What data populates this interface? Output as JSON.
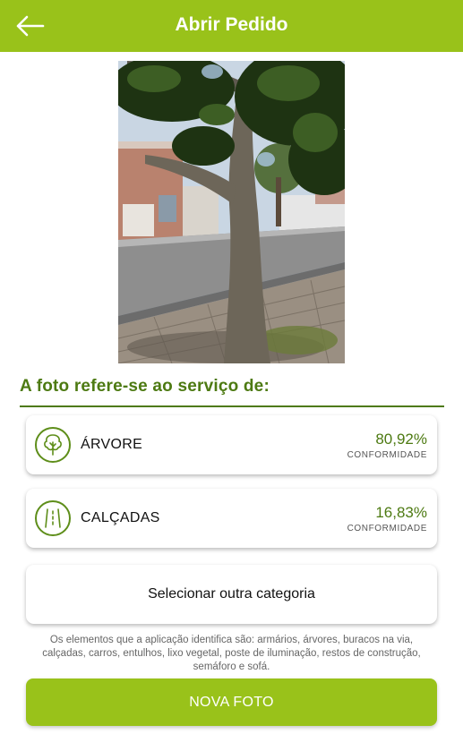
{
  "header": {
    "title": "Abrir Pedido",
    "back_icon": "arrow-left-icon"
  },
  "photo": {
    "description_icon": "tree-photo"
  },
  "section": {
    "title": "A foto refere-se ao serviço de:"
  },
  "categories": [
    {
      "label": "ÁRVORE",
      "percentage": "80,92%",
      "conformity_label": "CONFORMIDADE",
      "icon": "tree-icon"
    },
    {
      "label": "CALÇADAS",
      "percentage": "16,83%",
      "conformity_label": "CONFORMIDADE",
      "icon": "sidewalk-icon"
    }
  ],
  "other_category": {
    "label": "Selecionar outra categoria"
  },
  "info": {
    "text": "Os elementos que a aplicação identifica são: armários, árvores, buracos na via, calçadas, carros, entulhos, lixo vegetal, poste de iluminação, restos de construção, semáforo e sofá."
  },
  "new_photo": {
    "label": "NOVA FOTO"
  },
  "colors": {
    "brand": "#99c21a",
    "accent_dark": "#4d7a12"
  }
}
